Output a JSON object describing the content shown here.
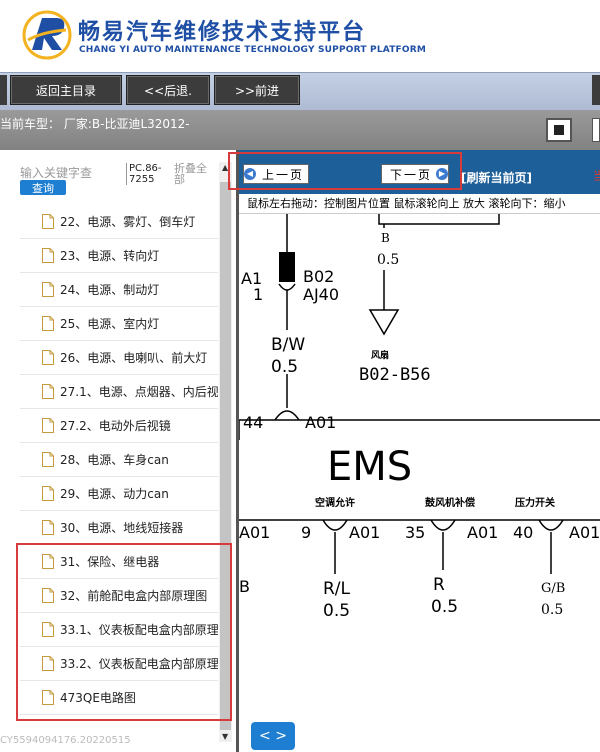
{
  "header": {
    "title_cn": "畅易汽车维修技术支持平台",
    "title_en": "CHANG YI AUTO MAINTENANCE TECHNOLOGY SUPPORT PLATFORM"
  },
  "nav": {
    "home": "返回主目录",
    "back": "<<后退.",
    "forward": ">>前进"
  },
  "vehicle": {
    "label": "当前车型：",
    "value": "厂家:B-比亚迪L32012-"
  },
  "search": {
    "placeholder": "输入关键字查",
    "button": "查询",
    "pc_info": "PC.86-7255",
    "fold": "折叠全部"
  },
  "tree": [
    {
      "label": "22、电源、雾灯、倒车灯"
    },
    {
      "label": "23、电源、转向灯"
    },
    {
      "label": "24、电源、制动灯"
    },
    {
      "label": "25、电源、室内灯"
    },
    {
      "label": "26、电源、电喇叭、前大灯"
    },
    {
      "label": "27.1、电源、点烟器、内后视"
    },
    {
      "label": "27.2、电动外后视镜"
    },
    {
      "label": "28、电源、车身can"
    },
    {
      "label": "29、电源、动力can"
    },
    {
      "label": "30、电源、地线短接器"
    },
    {
      "label": "31、保险、继电器"
    },
    {
      "label": "32、前舱配电盒内部原理图"
    },
    {
      "label": "33.1、仪表板配电盒内部原理"
    },
    {
      "label": "33.2、仪表板配电盒内部原理"
    },
    {
      "label": "473QE电路图"
    }
  ],
  "footer_id": "CY5594094176.20220515",
  "viewer": {
    "prev": "上一页",
    "next": "下一页",
    "refresh": "[刷新当前页]",
    "cur_label": "当",
    "help": "鼠标左右拖动：控制图片位置  鼠标滚轮向上 放大  滚轮向下：缩小",
    "nav_pill": "< >"
  },
  "diagram": {
    "top_b": "B",
    "top_05": "0.5",
    "a1": "A1",
    "b02": "B02",
    "one": "1",
    "aj40": "AJ40",
    "bw": "B/W",
    "bw05": "0.5",
    "fan_label": "风扇",
    "b02b56": "B02-B56",
    "n44": "44",
    "a01_top": "A01",
    "ems": "EMS",
    "col1_label": "空调允许",
    "col2_label": "鼓风机补偿",
    "col3_label": "压力开关",
    "a01_1": "A01",
    "n9": "9",
    "a01_2": "A01",
    "n35": "35",
    "a01_3": "A01",
    "n40": "40",
    "a01_4": "A01",
    "b_left": "B",
    "rl": "R/L",
    "rl05": "0.5",
    "r": "R",
    "r05": "0.5",
    "gb": "G/B",
    "gb05": "0.5"
  }
}
